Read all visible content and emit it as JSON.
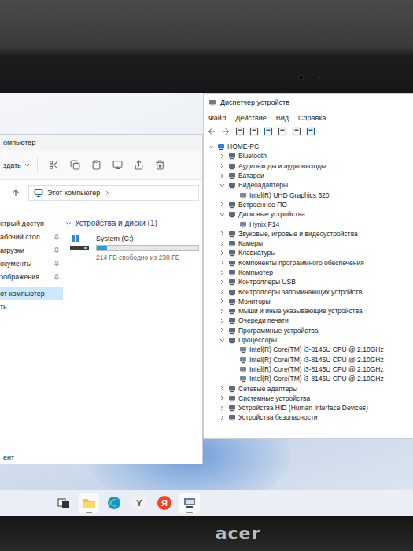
{
  "bezel": {
    "logo": "acer"
  },
  "explorer": {
    "title": "омпьютер",
    "toolbar": {
      "new": "здать"
    },
    "address": {
      "path": "Этот компьютер"
    },
    "sidebar": {
      "items": [
        {
          "label": "стрый доступ",
          "pinned": false,
          "selected": false
        },
        {
          "label": "абочий стол",
          "pinned": true,
          "selected": false
        },
        {
          "label": "агрузки",
          "pinned": true,
          "selected": false
        },
        {
          "label": "окументы",
          "pinned": true,
          "selected": false
        },
        {
          "label": "зображения",
          "pinned": true,
          "selected": false
        },
        {
          "label": "от компьютер",
          "pinned": false,
          "selected": true
        },
        {
          "label": "ть",
          "pinned": false,
          "selected": false
        }
      ]
    },
    "section": {
      "title": "Устройства и диски (1)",
      "expanded": true
    },
    "drives": [
      {
        "name": "System (C:)",
        "free": "214 ГБ свободно из 238 ГБ",
        "level": 0.1
      }
    ],
    "status_bar": "ент"
  },
  "device_manager": {
    "title": "Диспетчер устройств",
    "menu": [
      "Файл",
      "Действие",
      "Вид",
      "Справка"
    ],
    "tree": {
      "root": {
        "label": "HOME-PC",
        "expanded": true
      },
      "categories": [
        {
          "label": "Bluetooth",
          "expanded": false,
          "children": []
        },
        {
          "label": "Аудиовходы и аудиовыходы",
          "expanded": false,
          "children": []
        },
        {
          "label": "Батареи",
          "expanded": false,
          "children": []
        },
        {
          "label": "Видеоадаптеры",
          "expanded": true,
          "children": [
            {
              "label": "Intel(R) UHD Graphics 620"
            }
          ]
        },
        {
          "label": "Встроенное ПО",
          "expanded": false,
          "children": []
        },
        {
          "label": "Дисковые устройства",
          "expanded": true,
          "children": [
            {
              "label": "Hynix F14"
            }
          ]
        },
        {
          "label": "Звуковые, игровые и видеоустройства",
          "expanded": false,
          "children": []
        },
        {
          "label": "Камеры",
          "expanded": false,
          "children": []
        },
        {
          "label": "Клавиатуры",
          "expanded": false,
          "children": []
        },
        {
          "label": "Компоненты программного обеспечения",
          "expanded": false,
          "children": []
        },
        {
          "label": "Компьютер",
          "expanded": false,
          "children": []
        },
        {
          "label": "Контроллеры USB",
          "expanded": false,
          "children": []
        },
        {
          "label": "Контроллеры запоминающих устройств",
          "expanded": false,
          "children": []
        },
        {
          "label": "Мониторы",
          "expanded": false,
          "children": []
        },
        {
          "label": "Мыши и иные указывающие устройства",
          "expanded": false,
          "children": []
        },
        {
          "label": "Очереди печати",
          "expanded": false,
          "children": []
        },
        {
          "label": "Программные устройства",
          "expanded": false,
          "children": []
        },
        {
          "label": "Процессоры",
          "expanded": true,
          "children": [
            {
              "label": "Intel(R) Core(TM) i3-8145U CPU @ 2.10GHz"
            },
            {
              "label": "Intel(R) Core(TM) i3-8145U CPU @ 2.10GHz"
            },
            {
              "label": "Intel(R) Core(TM) i3-8145U CPU @ 2.10GHz"
            },
            {
              "label": "Intel(R) Core(TM) i3-8145U CPU @ 2.10GHz"
            }
          ]
        },
        {
          "label": "Сетевые адаптеры",
          "expanded": false,
          "children": []
        },
        {
          "label": "Системные устройства",
          "expanded": false,
          "children": []
        },
        {
          "label": "Устройства HID (Human Interface Devices)",
          "expanded": false,
          "children": []
        },
        {
          "label": "Устройства безопасности",
          "expanded": false,
          "children": []
        }
      ]
    }
  },
  "taskbar": {
    "apps": [
      {
        "kind": "task-view",
        "running": false
      },
      {
        "kind": "explorer",
        "running": true
      },
      {
        "kind": "edge",
        "running": false
      },
      {
        "kind": "yandex-browser",
        "glyph": "Y",
        "running": false
      },
      {
        "kind": "yandex",
        "glyph": "Я",
        "running": false
      },
      {
        "kind": "device-manager",
        "running": true
      }
    ]
  }
}
